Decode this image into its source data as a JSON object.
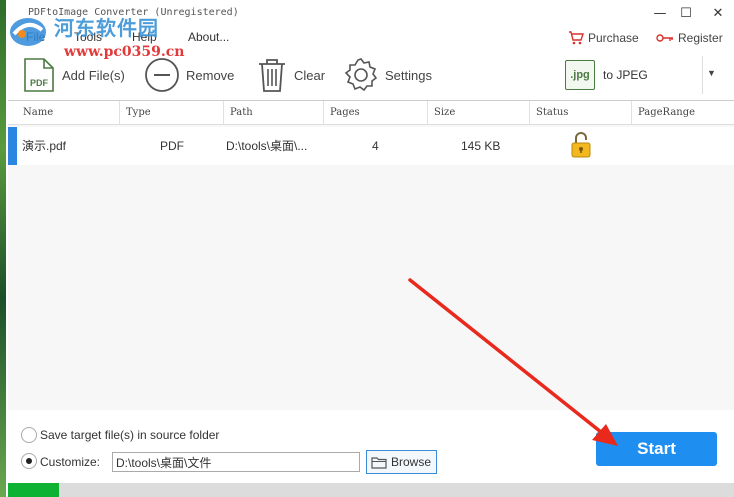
{
  "window": {
    "title": "PDFtoImage Converter (Unregistered)",
    "minimize": "—",
    "maximize": "☐",
    "close": "✕"
  },
  "watermark": {
    "site_name": "河东软件园",
    "url": "www.pc0359.cn"
  },
  "menu": {
    "file": "File",
    "tools": "Tools",
    "help": "Help",
    "about": "About..."
  },
  "links": {
    "purchase": "Purchase",
    "register": "Register"
  },
  "toolbar": {
    "add_files": "Add File(s)",
    "remove": "Remove",
    "clear": "Clear",
    "settings": "Settings",
    "format_icon_text": ".jpg",
    "format_label": "to JPEG"
  },
  "table": {
    "columns": [
      "Name",
      "Type",
      "Path",
      "Pages",
      "Size",
      "Status",
      "PageRange"
    ],
    "rows": [
      {
        "name": "演示.pdf",
        "type": "PDF",
        "path": "D:\\tools\\桌面\\...",
        "pages": "4",
        "size": "145 KB",
        "status": "unlocked-icon",
        "page_range": ""
      }
    ]
  },
  "output": {
    "save_in_source_label": "Save target file(s) in source folder",
    "save_in_source_selected": false,
    "customize_label": "Customize:",
    "customize_selected": true,
    "folder_path": "D:\\tools\\桌面\\文件",
    "browse_label": "Browse"
  },
  "start_label": "Start",
  "progress_percent": 7,
  "colors": {
    "accent_blue": "#1f8ef1",
    "progress_green": "#0db233",
    "annotation_red": "#e8291c"
  }
}
